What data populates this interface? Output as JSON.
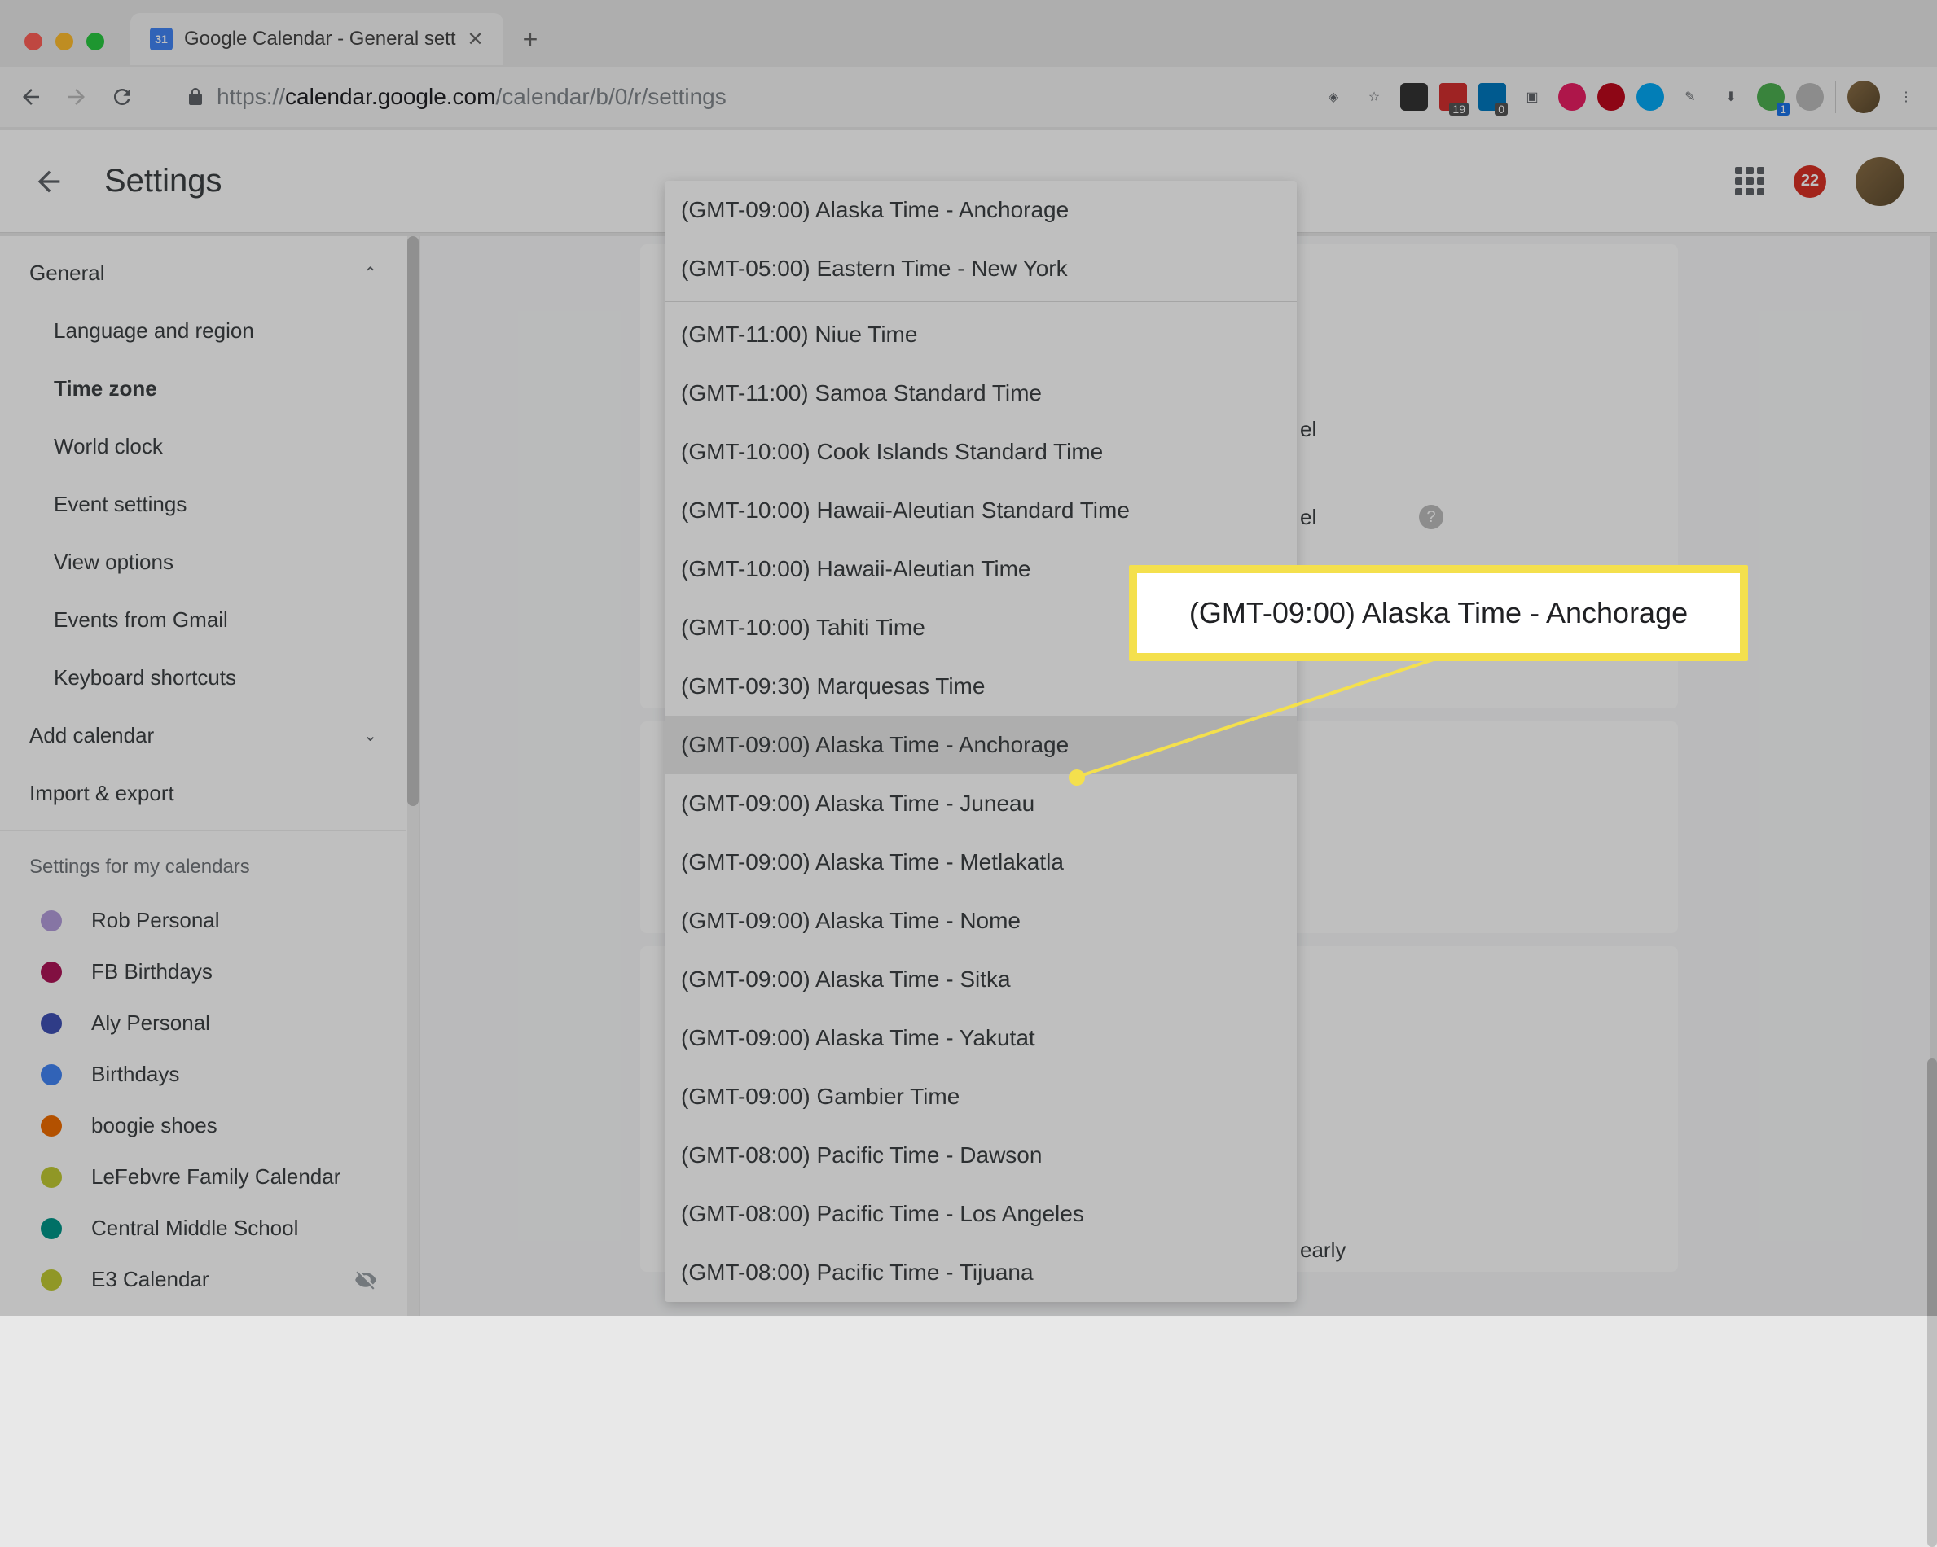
{
  "browser": {
    "tab_title": "Google Calendar - General sett",
    "url_protocol": "https://",
    "url_domain": "calendar.google.com",
    "url_path": "/calendar/b/0/r/settings",
    "favicon_text": "31",
    "pocket_badge": "19",
    "trello_badge": "0",
    "gsuite_badge": "1"
  },
  "header": {
    "title": "Settings",
    "notif_count": "22"
  },
  "sidebar": {
    "general": "General",
    "items": [
      "Language and region",
      "Time zone",
      "World clock",
      "Event settings",
      "View options",
      "Events from Gmail",
      "Keyboard shortcuts"
    ],
    "add_calendar": "Add calendar",
    "import_export": "Import & export",
    "my_cals_title": "Settings for my calendars",
    "calendars": [
      {
        "name": "Rob Personal",
        "color": "#b39ddb"
      },
      {
        "name": "FB Birthdays",
        "color": "#ad1457"
      },
      {
        "name": "Aly Personal",
        "color": "#3f51b5"
      },
      {
        "name": "Birthdays",
        "color": "#4285f4"
      },
      {
        "name": "boogie shoes",
        "color": "#ef6c00"
      },
      {
        "name": "LeFebvre Family Calendar",
        "color": "#c0ca33"
      },
      {
        "name": "Central Middle School",
        "color": "#009688"
      },
      {
        "name": "E3 Calendar",
        "color": "#c0ca33",
        "hidden": true
      }
    ]
  },
  "dropdown": {
    "recent": [
      "(GMT-09:00) Alaska Time - Anchorage",
      "(GMT-05:00) Eastern Time - New York"
    ],
    "items": [
      "(GMT-11:00) Niue Time",
      "(GMT-11:00) Samoa Standard Time",
      "(GMT-10:00) Cook Islands Standard Time",
      "(GMT-10:00) Hawaii-Aleutian Standard Time",
      "(GMT-10:00) Hawaii-Aleutian Time",
      "(GMT-10:00) Tahiti Time",
      "(GMT-09:30) Marquesas Time",
      "(GMT-09:00) Alaska Time - Anchorage",
      "(GMT-09:00) Alaska Time - Juneau",
      "(GMT-09:00) Alaska Time - Metlakatla",
      "(GMT-09:00) Alaska Time - Nome",
      "(GMT-09:00) Alaska Time - Sitka",
      "(GMT-09:00) Alaska Time - Yakutat",
      "(GMT-09:00) Gambier Time",
      "(GMT-08:00) Pacific Time - Dawson",
      "(GMT-08:00) Pacific Time - Los Angeles",
      "(GMT-08:00) Pacific Time - Tijuana"
    ],
    "selected_index": 7
  },
  "callout": {
    "text": "(GMT-09:00) Alaska Time - Anchorage"
  },
  "peek": {
    "label1": "el",
    "label2": "el",
    "early": "early"
  }
}
